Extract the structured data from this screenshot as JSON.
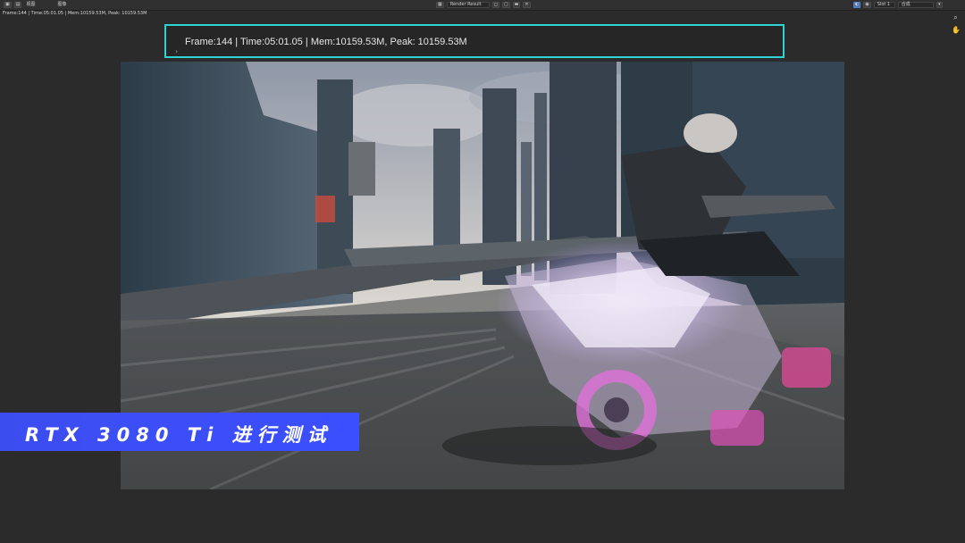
{
  "header": {
    "left_menu": [
      "视图",
      "图像"
    ],
    "view_label": "视图",
    "image_label": "图像",
    "render_result": "Render Result",
    "slot_label": "Slot 1",
    "layer_label": "合成"
  },
  "stats": {
    "text": "Frame:144 | Time:05:01.05 | Mem:10159.53M, Peak: 10159.53M"
  },
  "callout": {
    "text": "Frame:144 | Time:05:01.05 | Mem:10159.53M, Peak: 10159.53M"
  },
  "banner": {
    "text": "RTX 3080 Ti 进行测试"
  },
  "colors": {
    "highlight": "#2fd3d3",
    "banner": "#3b4fff",
    "background": "#2b2b2b"
  },
  "icons": {
    "zoom": "magnifier-icon",
    "pan": "hand-icon"
  }
}
